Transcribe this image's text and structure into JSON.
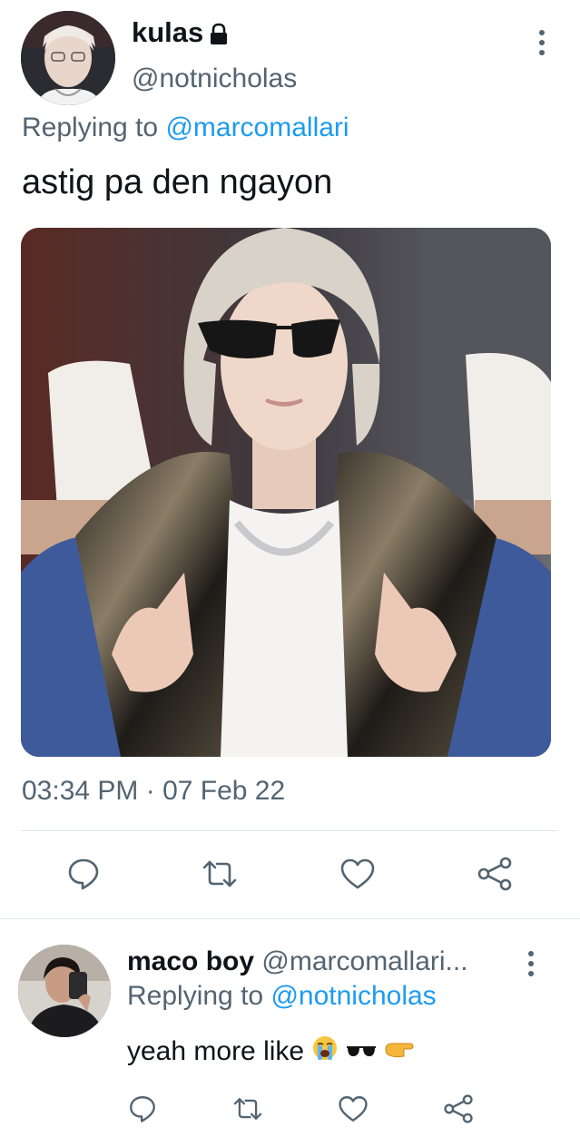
{
  "main_tweet": {
    "display_name": "kulas",
    "protected_icon": "lock-icon",
    "handle": "@notnicholas",
    "replying_prefix": "Replying to",
    "replying_to": "@marcomallari",
    "text": "astig pa den ngayon",
    "timestamp": "03:34 PM · 07 Feb 22",
    "actions": [
      "reply-icon",
      "retweet-icon",
      "like-icon",
      "share-icon"
    ]
  },
  "reply_tweet": {
    "display_name": "maco boy",
    "handle": "@marcomallari...",
    "replying_prefix": "Replying to",
    "replying_to": "@notnicholas",
    "text": "yeah more like",
    "emojis": [
      "loudly-crying-face-icon",
      "sunglasses-icon",
      "pointing-hand-icon"
    ],
    "actions": [
      "reply-icon",
      "retweet-icon",
      "like-icon",
      "share-icon"
    ]
  },
  "colors": {
    "text": "#0f1419",
    "secondary": "#536471",
    "link": "#1d9bf0",
    "divider": "#e1e6ea"
  }
}
